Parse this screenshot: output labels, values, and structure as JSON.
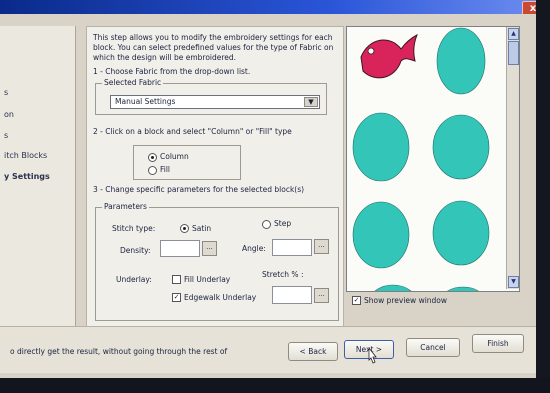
{
  "nav": {
    "items": [
      "s",
      "on",
      "s",
      "itch Blocks",
      "y Settings"
    ]
  },
  "intro": {
    "line1": "This step allows you to modify the embroidery settings for each",
    "line2": "block. You can select predefined values for the type of Fabric on",
    "line3": "which the design will be embroidered."
  },
  "step1": {
    "text": "1 - Choose Fabric from the drop-down list.",
    "group_label": "Selected Fabric",
    "fabric_value": "Manual Settings"
  },
  "step2": {
    "text": "2 - Click on a block and select \"Column\" or \"Fill\" type",
    "column_label": "Column",
    "fill_label": "Fill"
  },
  "step3": {
    "text": "3 - Change specific parameters for the selected block(s)",
    "group_label": "Parameters",
    "stitch_type_label": "Stitch type:",
    "satin_label": "Satin",
    "step_label": "Step",
    "density_label": "Density:",
    "angle_label": "Angle:",
    "underlay_label": "Underlay:",
    "fill_underlay_label": "Fill Underlay",
    "edgewalk_label": "Edgewalk Underlay",
    "stretch_label": "Stretch % :",
    "dots": "..."
  },
  "preview": {
    "show_preview_label": "Show preview window",
    "fill_color": "#33c6b8",
    "fish_color": "#d8245a"
  },
  "footer": {
    "hint": "o directly get the result, without going through the rest of",
    "back": "< Back",
    "next": "Next >",
    "cancel": "Cancel",
    "finish": "Finish"
  },
  "window": {
    "close": "x"
  }
}
